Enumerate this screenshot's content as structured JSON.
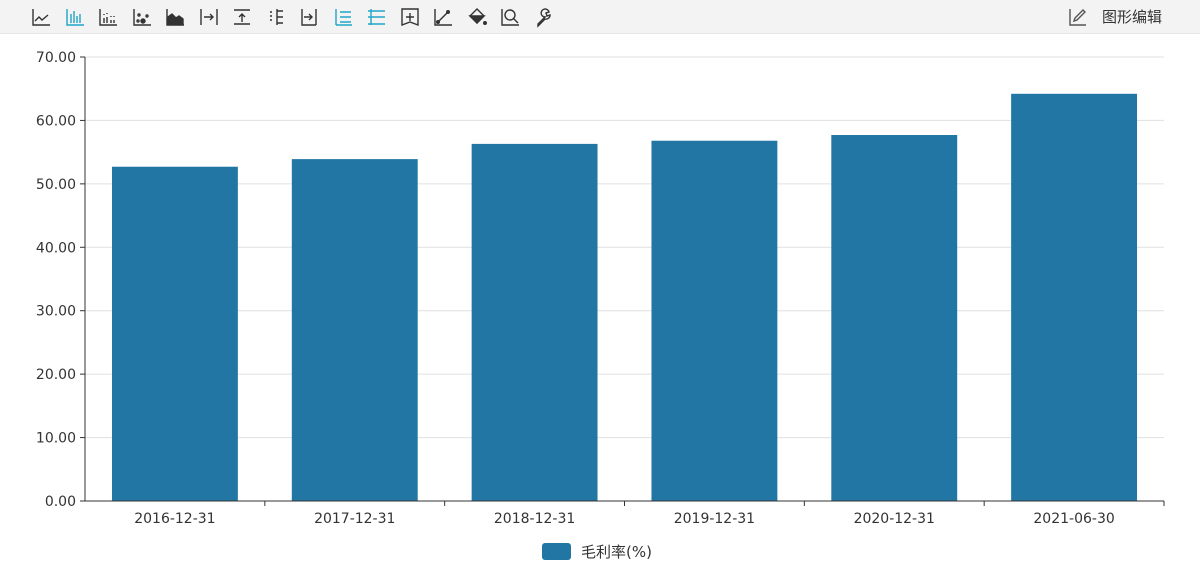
{
  "toolbar": {
    "icons": [
      "line-chart-icon",
      "bar-chart-icon",
      "grouped-bar-icon",
      "scatter-icon",
      "area-chart-icon",
      "align-right-icon",
      "align-top-icon",
      "horizontal-axis-icon",
      "align-end-icon",
      "list-icon",
      "gridlines-icon",
      "add-box-icon",
      "trendline-icon",
      "fill-color-icon",
      "zoom-icon",
      "settings-wrench-icon"
    ],
    "active_color": "#1fa6c8",
    "edit_label": "图形编辑"
  },
  "chart_data": {
    "type": "bar",
    "categories": [
      "2016-12-31",
      "2017-12-31",
      "2018-12-31",
      "2019-12-31",
      "2020-12-31",
      "2021-06-30"
    ],
    "series": [
      {
        "name": "毛利率(%)",
        "values": [
          52.7,
          53.9,
          56.3,
          56.8,
          57.7,
          64.2
        ],
        "color": "#2176a3"
      }
    ],
    "yticks": [
      "0.00",
      "10.00",
      "20.00",
      "30.00",
      "40.00",
      "50.00",
      "60.00",
      "70.00"
    ],
    "ylim": [
      0,
      70
    ],
    "grid": true,
    "legend": "bottom"
  }
}
